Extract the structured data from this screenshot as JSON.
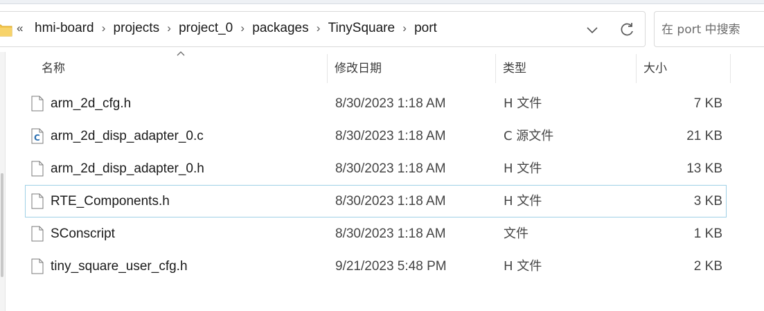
{
  "address": {
    "overflow_chevron": "«",
    "breadcrumbs": [
      "hmi-board",
      "projects",
      "project_0",
      "packages",
      "TinySquare",
      "port"
    ],
    "separator": "›"
  },
  "search": {
    "placeholder": "在 port 中搜索"
  },
  "columns": {
    "name": "名称",
    "modified": "修改日期",
    "type": "类型",
    "size": "大小",
    "sorted_column": "name"
  },
  "files": [
    {
      "name": "arm_2d_cfg.h",
      "modified": "8/30/2023 1:18 AM",
      "type": "H 文件",
      "size": "7 KB",
      "icon": "blank-file-icon"
    },
    {
      "name": "arm_2d_disp_adapter_0.c",
      "modified": "8/30/2023 1:18 AM",
      "type": "C 源文件",
      "size": "21 KB",
      "icon": "c-source-file-icon"
    },
    {
      "name": "arm_2d_disp_adapter_0.h",
      "modified": "8/30/2023 1:18 AM",
      "type": "H 文件",
      "size": "13 KB",
      "icon": "blank-file-icon"
    },
    {
      "name": "RTE_Components.h",
      "modified": "8/30/2023 1:18 AM",
      "type": "H 文件",
      "size": "3 KB",
      "icon": "blank-file-icon",
      "selected": true
    },
    {
      "name": "SConscript",
      "modified": "8/30/2023 1:18 AM",
      "type": "文件",
      "size": "1 KB",
      "icon": "blank-file-icon"
    },
    {
      "name": "tiny_square_user_cfg.h",
      "modified": "9/21/2023 5:48 PM",
      "type": "H 文件",
      "size": "2 KB",
      "icon": "blank-file-icon"
    }
  ],
  "colors": {
    "selection_border": "#9fd0e6",
    "folder": "#f3c54a",
    "c_icon": "#2a6fb0"
  }
}
